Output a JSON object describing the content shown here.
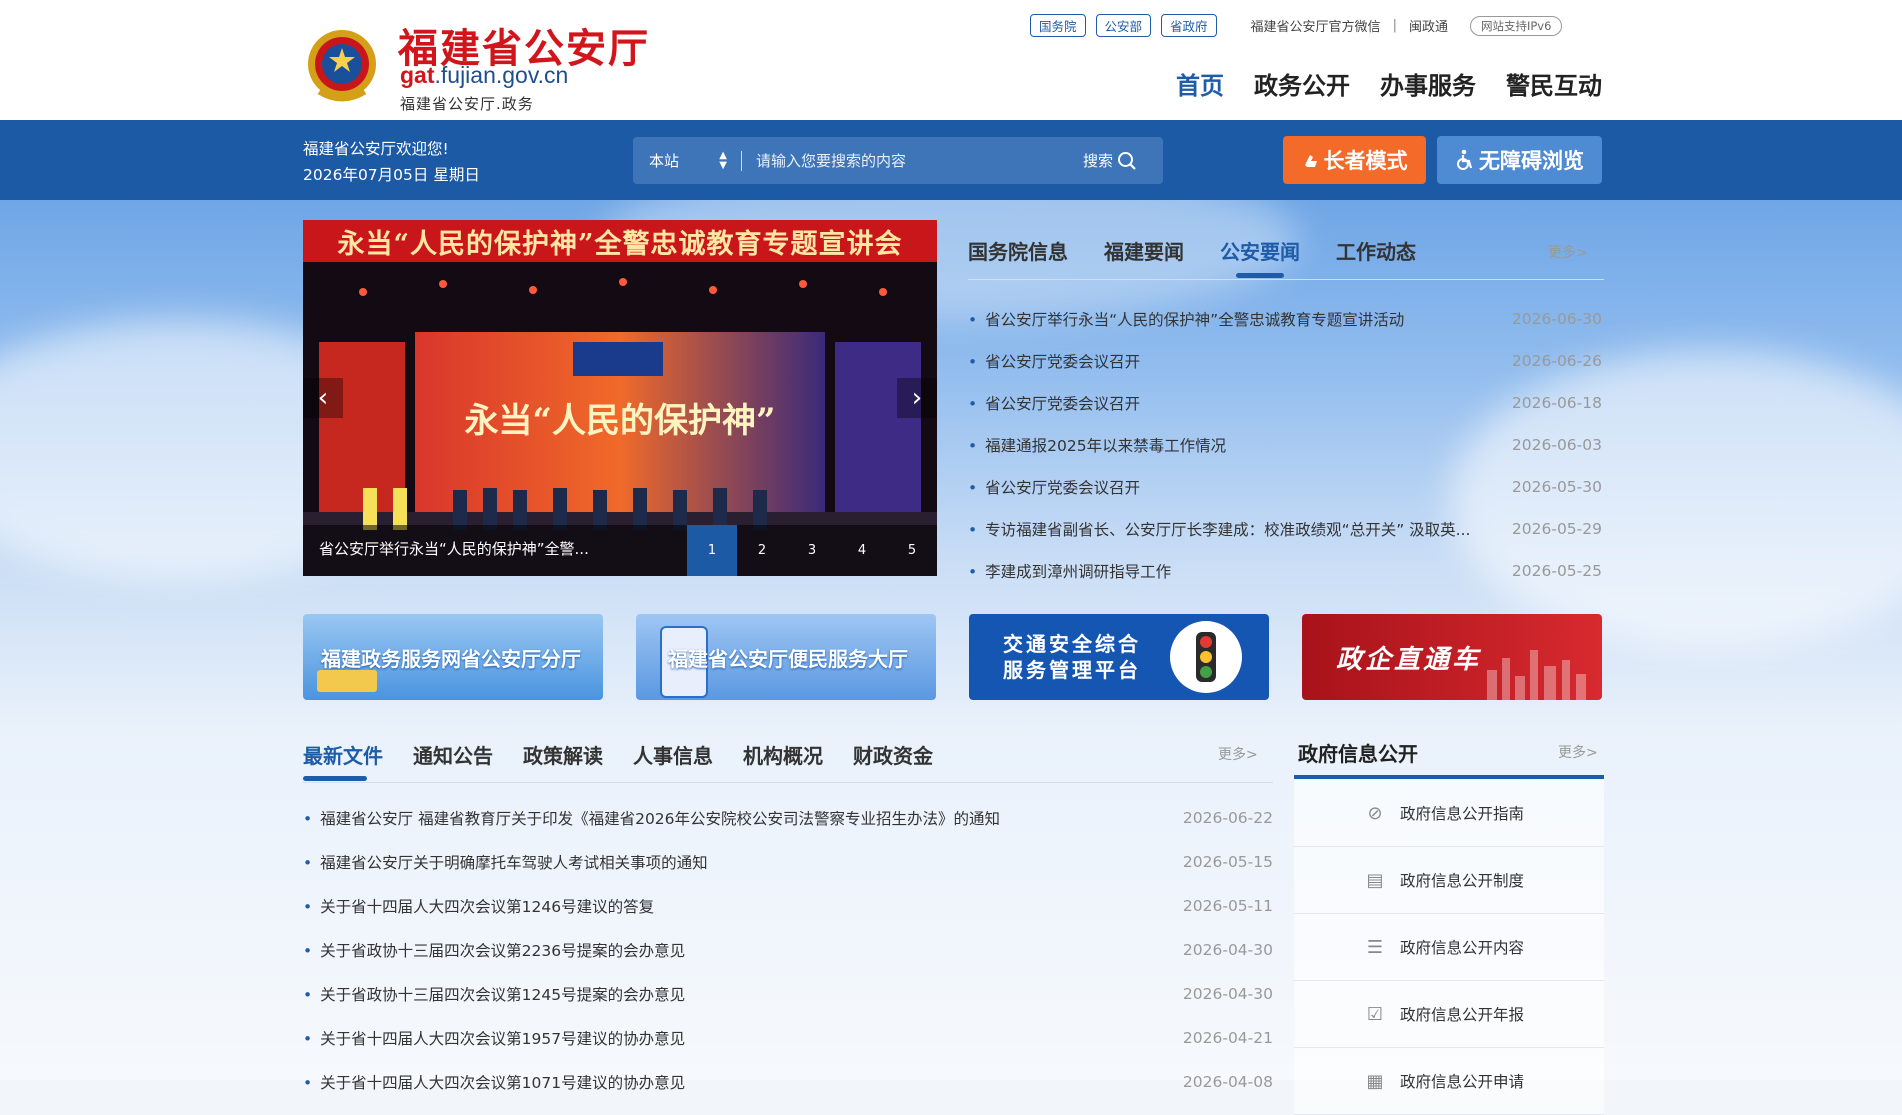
{
  "header": {
    "site_title": "福建省公安厅",
    "domain_prefix": "gat",
    "domain_suffix": ".fujian.gov.cn",
    "subtitle": "福建省公安厅.政务",
    "top_tags": [
      "国务院",
      "公安部",
      "省政府"
    ],
    "wechat": "福建省公安厅官方微信",
    "sep": "|",
    "minzhengtong": "闽政通",
    "ipv6": "网站支持IPv6",
    "nav": [
      "首页",
      "政务公开",
      "办事服务",
      "警民互动"
    ]
  },
  "bar": {
    "welcome": "福建省公安厅欢迎您!",
    "date": "2026年07月05日 星期日",
    "search_scope": "本站",
    "search_placeholder": "请输入您要搜索的内容",
    "search_button": "搜索",
    "elder_mode": "长者模式",
    "accessible": "无障碍浏览"
  },
  "carousel": {
    "banner": "永当“人民的保护神”全警忠诚教育专题宣讲会",
    "stage_text": "永当“人民的保护神”",
    "caption": "省公安厅举行永当“人民的保护神”全警...",
    "dots": [
      "1",
      "2",
      "3",
      "4",
      "5"
    ],
    "prev": "‹",
    "next": "›"
  },
  "news": {
    "tabs": [
      "国务院信息",
      "福建要闻",
      "公安要闻",
      "工作动态"
    ],
    "more": "更多>",
    "items": [
      {
        "title": "省公安厅举行永当“人民的保护神”全警忠诚教育专题宣讲活动",
        "date": "2026-06-30"
      },
      {
        "title": "省公安厅党委会议召开",
        "date": "2026-06-26"
      },
      {
        "title": "省公安厅党委会议召开",
        "date": "2026-06-18"
      },
      {
        "title": "福建通报2025年以来禁毒工作情况",
        "date": "2026-06-03"
      },
      {
        "title": "省公安厅党委会议召开",
        "date": "2026-05-30"
      },
      {
        "title": "专访福建省副省长、公安厅厅长李建成：校准政绩观“总开关” 汲取英...",
        "date": "2026-05-29"
      },
      {
        "title": "李建成到漳州调研指导工作",
        "date": "2026-05-25"
      }
    ]
  },
  "banners": {
    "b1": "福建政务服务网省公安厅分厅",
    "b2": "福建省公安厅便民服务大厅",
    "b3_line1": "交通安全综合",
    "b3_line2": "服务管理平台",
    "b4": "政企直通车"
  },
  "docs": {
    "tabs": [
      "最新文件",
      "通知公告",
      "政策解读",
      "人事信息",
      "机构概况",
      "财政资金"
    ],
    "more": "更多>",
    "items": [
      {
        "title": "福建省公安厅 福建省教育厅关于印发《福建省2026年公安院校公安司法警察专业招生办法》的通知",
        "date": "2026-06-22"
      },
      {
        "title": "福建省公安厅关于明确摩托车驾驶人考试相关事项的通知",
        "date": "2026-05-15"
      },
      {
        "title": "关于省十四届人大四次会议第1246号建议的答复",
        "date": "2026-05-11"
      },
      {
        "title": "关于省政协十三届四次会议第2236号提案的会办意见",
        "date": "2026-04-30"
      },
      {
        "title": "关于省政协十三届四次会议第1245号提案的会办意见",
        "date": "2026-04-30"
      },
      {
        "title": "关于省十四届人大四次会议第1957号建议的协办意见",
        "date": "2026-04-21"
      },
      {
        "title": "关于省十四届人大四次会议第1071号建议的协办意见",
        "date": "2026-04-08"
      }
    ]
  },
  "gov": {
    "title": "政府信息公开",
    "more": "更多>",
    "items": [
      "政府信息公开指南",
      "政府信息公开制度",
      "政府信息公开内容",
      "政府信息公开年报",
      "政府信息公开申请"
    ]
  }
}
